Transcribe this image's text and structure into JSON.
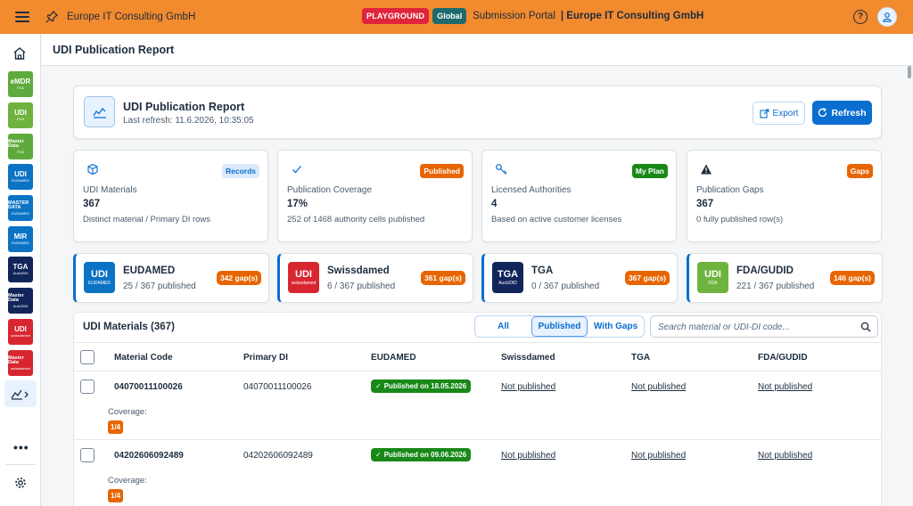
{
  "topbar": {
    "company": "Europe IT Consulting GmbH",
    "env_badge": "PLAYGROUND",
    "scope_badge": "Global",
    "portal_label": "Submission Portal",
    "portal_company": "| Europe IT Consulting GmbH"
  },
  "sidebar": {
    "tiles": [
      {
        "l1": "eMDR",
        "l2": "FDA",
        "color": "#5faa3c"
      },
      {
        "l1": "UDI",
        "l2": "FDA",
        "color": "#6fb33f"
      },
      {
        "l1": "Master Data",
        "l2": "FDA",
        "color": "#5faa3c"
      },
      {
        "l1": "UDI",
        "l2": "EUDAMED",
        "color": "#0b73c4"
      },
      {
        "l1": "MASTER DATA",
        "l2": "EUDAMED",
        "color": "#0b73c4"
      },
      {
        "l1": "MIR",
        "l2": "EUDAMED",
        "color": "#0b73c4"
      },
      {
        "l1": "TGA",
        "l2": "AusUDID",
        "color": "#12255a"
      },
      {
        "l1": "Master Data",
        "l2": "AusUDID",
        "color": "#12255a"
      },
      {
        "l1": "UDI",
        "l2": "swissdamed",
        "color": "#d72630"
      },
      {
        "l1": "Master Data",
        "l2": "swissdamed",
        "color": "#d72630"
      }
    ],
    "more": "•••"
  },
  "page": {
    "title": "UDI Publication Report"
  },
  "report": {
    "title": "UDI Publication Report",
    "last_refresh": "Last refresh: 11.6.2026, 10:35:05",
    "export_label": "Export",
    "refresh_label": "Refresh"
  },
  "kpis": [
    {
      "tag": "Records",
      "label": "UDI Materials",
      "value": "367",
      "desc": "Distinct material / Primary DI rows",
      "tag_bg": "#dbe9fb",
      "tag_fg": "#0a6ed1"
    },
    {
      "tag": "Published",
      "label": "Publication Coverage",
      "value": "17%",
      "desc": "252 of 1468 authority cells published",
      "tag_bg": "#e76500",
      "tag_fg": "#ffffff"
    },
    {
      "tag": "My Plan",
      "label": "Licensed Authorities",
      "value": "4",
      "desc": "Based on active customer licenses",
      "tag_bg": "#188918",
      "tag_fg": "#ffffff"
    },
    {
      "tag": "Gaps",
      "label": "Publication Gaps",
      "value": "367",
      "desc": "0 fully published row(s)",
      "tag_bg": "#e76500",
      "tag_fg": "#ffffff"
    }
  ],
  "authorities": [
    {
      "name": "EUDAMED",
      "count": "25 / 367 published",
      "gaps": "342 gap(s)",
      "logo_l1": "UDI",
      "logo_l2": "EUDAMED",
      "logo_color": "#0b73c4"
    },
    {
      "name": "Swissdamed",
      "count": "6 / 367 published",
      "gaps": "361 gap(s)",
      "logo_l1": "UDI",
      "logo_l2": "swissdamed",
      "logo_color": "#d72630"
    },
    {
      "name": "TGA",
      "count": "0 / 367 published",
      "gaps": "367 gap(s)",
      "logo_l1": "TGA",
      "logo_l2": "AusUDID",
      "logo_color": "#12255a"
    },
    {
      "name": "FDA/GUDID",
      "count": "221 / 367 published",
      "gaps": "146 gap(s)",
      "logo_l1": "UDI",
      "logo_l2": "FDA",
      "logo_color": "#6fb33f"
    }
  ],
  "table": {
    "title": "UDI Materials (367)",
    "filters": {
      "all": "All",
      "published": "Published",
      "gaps": "With Gaps"
    },
    "search_placeholder": "Search material or UDI-DI code...",
    "headers": [
      "Material Code",
      "Primary DI",
      "EUDAMED",
      "Swissdamed",
      "TGA",
      "FDA/GUDID"
    ],
    "coverage_label": "Coverage:",
    "rows": [
      {
        "code": "04070011100026",
        "di": "04070011100026",
        "eudamed": "Published on 18.05.2026",
        "swissdamed": "Not published",
        "tga": "Not published",
        "fda": "Not published",
        "coverage": "1/4"
      },
      {
        "code": "04202606092489",
        "di": "04202606092489",
        "eudamed": "Published on 09.06.2026",
        "swissdamed": "Not published",
        "tga": "Not published",
        "fda": "Not published",
        "coverage": "1/4"
      }
    ]
  },
  "colors": {
    "accent": "#0a6ed1",
    "topbar": "#f28a2e",
    "success": "#188918",
    "warning": "#e76500"
  }
}
